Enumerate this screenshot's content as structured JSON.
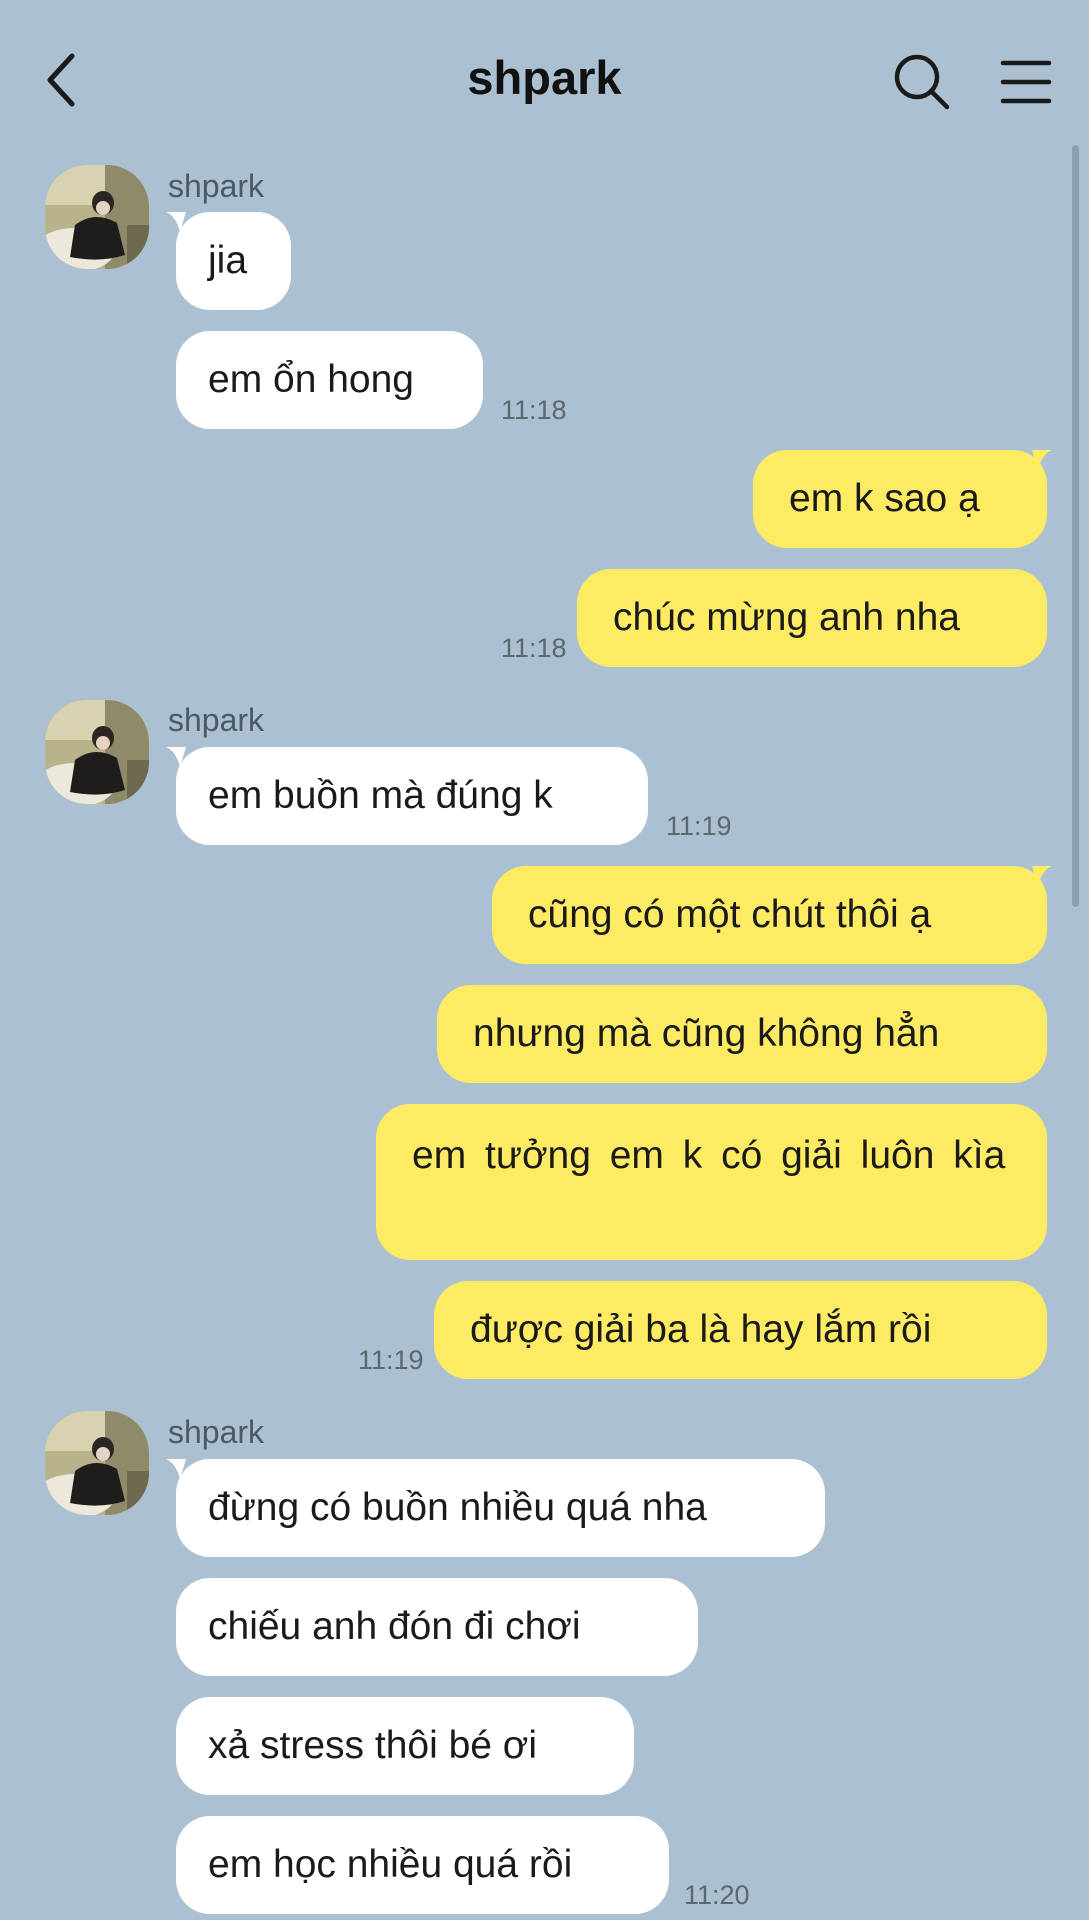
{
  "header": {
    "title": "shpark"
  },
  "messages": {
    "g1": {
      "sender": "shpark",
      "m1": "jia",
      "m2": "em ổn hong",
      "time": "11:18"
    },
    "g2": {
      "m1": "em k sao ạ",
      "m2": "chúc mừng anh nha",
      "time": "11:18"
    },
    "g3": {
      "sender": "shpark",
      "m1": "em buồn mà đúng k",
      "time": "11:19"
    },
    "g4": {
      "m1": "cũng có một chút thôi ạ",
      "m2": "nhưng mà cũng không hẳn",
      "m3": "em tưởng em k có giải luôn kìa",
      "m4": "được giải ba là hay lắm rồi",
      "time": "11:19"
    },
    "g5": {
      "sender": "shpark",
      "m1": "đừng có buồn nhiều quá nha",
      "m2": "chiếu anh đón đi chơi",
      "m3": "xả stress thôi bé ơi",
      "m4": "em học nhiều quá rồi",
      "time": "11:20"
    }
  },
  "colors": {
    "background": "#abc1d1",
    "incoming_bubble": "#ffffff",
    "outgoing_bubble": "#fdeb63"
  },
  "icons": {
    "back": "chevron-left-icon",
    "search": "search-icon",
    "menu": "hamburger-menu-icon",
    "avatar": "avatar"
  }
}
